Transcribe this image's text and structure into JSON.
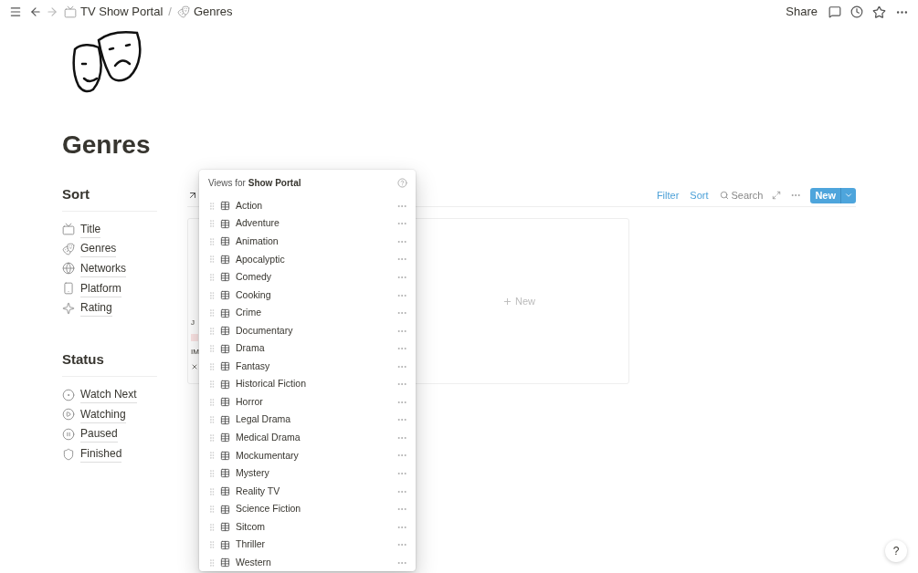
{
  "topbar": {
    "breadcrumbs": [
      {
        "label": "TV Show Portal"
      },
      {
        "label": "Genres"
      }
    ],
    "separator": "/",
    "share": "Share"
  },
  "page": {
    "title": "Genres"
  },
  "sections": [
    {
      "heading": "Sort",
      "items": [
        {
          "label": "Title"
        },
        {
          "label": "Genres"
        },
        {
          "label": "Networks"
        },
        {
          "label": "Platform"
        },
        {
          "label": "Rating"
        }
      ]
    },
    {
      "heading": "Status",
      "items": [
        {
          "label": "Watch Next"
        },
        {
          "label": "Watching"
        },
        {
          "label": "Paused"
        },
        {
          "label": "Finished"
        }
      ]
    }
  ],
  "database": {
    "toolbar": {
      "filter": "Filter",
      "sort": "Sort",
      "search": "Search",
      "new": "New"
    },
    "card_fragments": [
      "J",
      "IM"
    ],
    "add_new": "New"
  },
  "views_menu": {
    "prefix": "Views for ",
    "source": "Show Portal",
    "items": [
      "Action",
      "Adventure",
      "Animation",
      "Apocalyptic",
      "Comedy",
      "Cooking",
      "Crime",
      "Documentary",
      "Drama",
      "Fantasy",
      "Historical Fiction",
      "Horror",
      "Legal Drama",
      "Medical Drama",
      "Mockumentary",
      "Mystery",
      "Reality TV",
      "Science Fiction",
      "Sitcom",
      "Thriller",
      "Western"
    ]
  },
  "help": "?"
}
